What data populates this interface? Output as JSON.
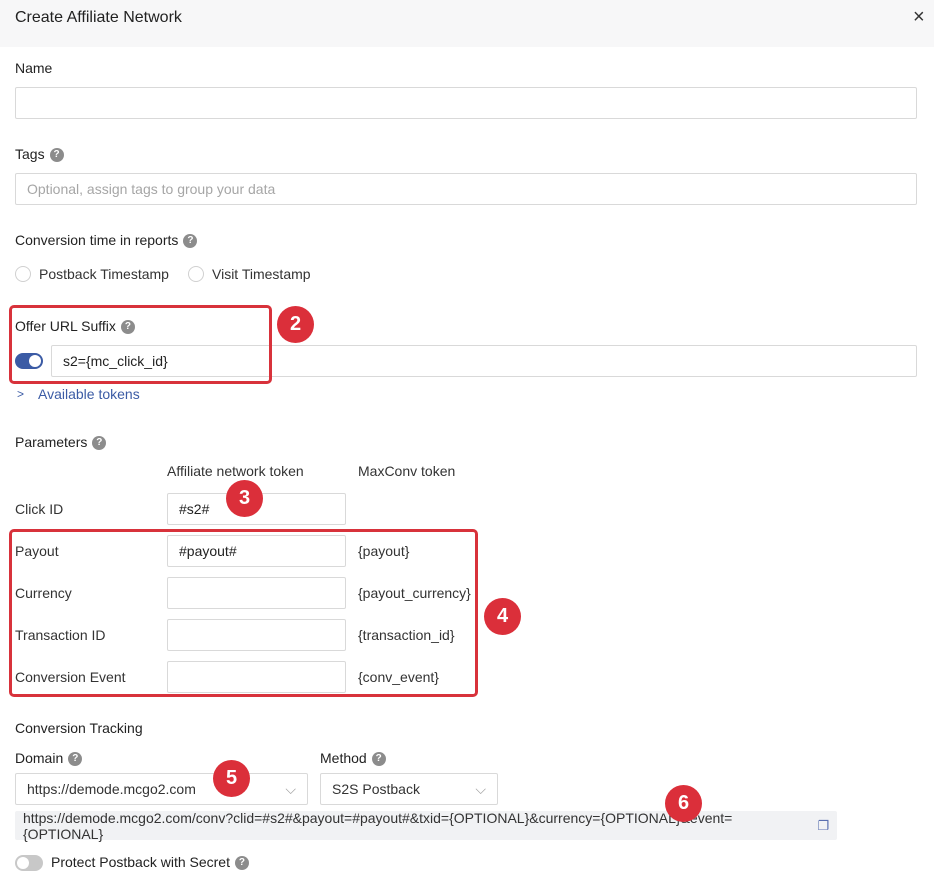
{
  "dialog": {
    "title": "Create Affiliate Network",
    "close_icon": "×"
  },
  "name": {
    "label": "Name",
    "value": "",
    "placeholder": ""
  },
  "tags": {
    "label": "Tags",
    "placeholder": "Optional, assign tags to group your data"
  },
  "conversion_time": {
    "label": "Conversion time in reports",
    "options": [
      "Postback Timestamp",
      "Visit Timestamp"
    ]
  },
  "offer_url_suffix": {
    "label": "Offer URL Suffix",
    "toggle_on": true,
    "value": "s2={mc_click_id}"
  },
  "available_tokens": {
    "chevron": ">",
    "label": "Available tokens"
  },
  "parameters": {
    "label": "Parameters",
    "col_network": "Affiliate network token",
    "col_maxconv": "MaxConv token",
    "rows": [
      {
        "label": "Click ID",
        "value": "#s2#",
        "token": ""
      },
      {
        "label": "Payout",
        "value": "#payout#",
        "token": "{payout}"
      },
      {
        "label": "Currency",
        "value": "",
        "token": "{payout_currency}"
      },
      {
        "label": "Transaction ID",
        "value": "",
        "token": "{transaction_id}"
      },
      {
        "label": "Conversion Event",
        "value": "",
        "token": "{conv_event}"
      }
    ]
  },
  "conversion_tracking": {
    "label": "Conversion Tracking",
    "domain_label": "Domain",
    "domain_value": "https://demode.mcgo2.com",
    "method_label": "Method",
    "method_value": "S2S Postback",
    "postback_url": "https://demode.mcgo2.com/conv?clid=#s2#&payout=#payout#&txid={OPTIONAL}&currency={OPTIONAL}&event={OPTIONAL}"
  },
  "protect_secret": {
    "label": "Protect Postback with Secret",
    "toggle_on": false
  },
  "help_glyph": "?",
  "select_arrow": "⌵",
  "copy_glyph": "❐",
  "annotations": [
    "2",
    "3",
    "4",
    "5",
    "6"
  ],
  "colors": {
    "accent": "#3b5ba5",
    "annotation_red": "#d8323b"
  }
}
